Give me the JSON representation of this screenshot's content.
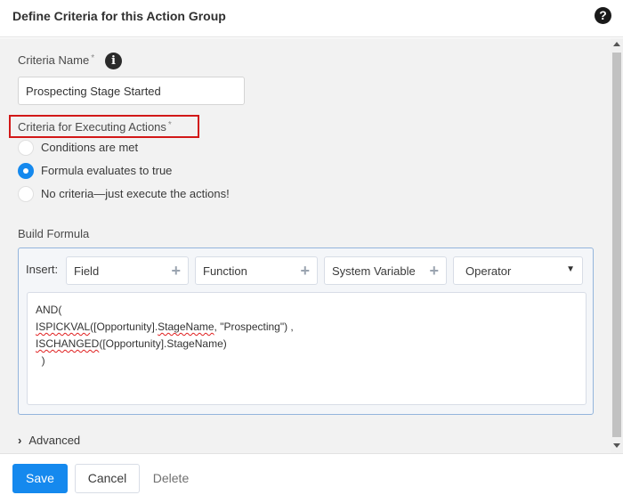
{
  "dialog": {
    "title": "Define Criteria for this Action Group",
    "help_icon": "question-circle-icon",
    "help_glyph": "?"
  },
  "criteria_name": {
    "label": "Criteria Name",
    "required_mark": "*",
    "info_icon": "info-icon",
    "info_glyph": "i",
    "value": "Prospecting Stage Started"
  },
  "criteria_executing": {
    "label": "Criteria for Executing Actions",
    "required_mark": "*",
    "options": [
      {
        "label": "Conditions are met",
        "selected": false
      },
      {
        "label": "Formula evaluates to true",
        "selected": true
      },
      {
        "label": "No criteria—just execute the actions!",
        "selected": false
      }
    ]
  },
  "build_formula": {
    "label": "Build Formula",
    "insert_label": "Insert:",
    "pickers": [
      {
        "label": "Field",
        "icon": "plus-icon",
        "glyph": "+"
      },
      {
        "label": "Function",
        "icon": "plus-icon",
        "glyph": "+"
      },
      {
        "label": "System Variable",
        "icon": "plus-icon",
        "glyph": "+"
      }
    ],
    "operator_select": {
      "label": "Operator",
      "icon": "caret-down-icon",
      "glyph": "▼"
    },
    "formula_lines": {
      "line1": "AND(",
      "line2_fn": "ISPICKVAL",
      "line2_rest_a": "([Opportunity].",
      "line2_field": "StageName",
      "line2_rest_b": ", \"Prospecting\") ,",
      "line3_fn": "ISCHANGED",
      "line3_rest_a": "([Opportunity].",
      "line3_field": "StageName",
      "line3_rest_b": ")",
      "line4": "  )"
    }
  },
  "advanced": {
    "label": "Advanced",
    "icon": "chevron-right-icon",
    "glyph": "›"
  },
  "footer": {
    "save_label": "Save",
    "cancel_label": "Cancel",
    "delete_label": "Delete"
  },
  "colors": {
    "accent": "#1589ee",
    "highlight_border": "#d21818",
    "panel_border": "#94b5dc"
  }
}
